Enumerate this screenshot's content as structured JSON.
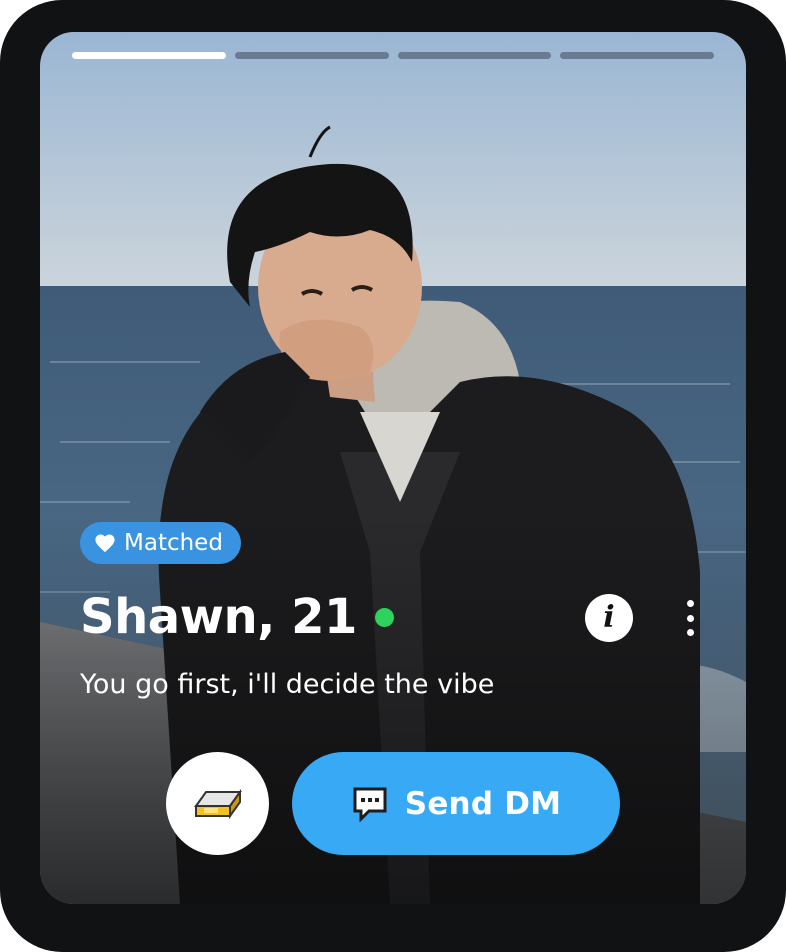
{
  "profile": {
    "badge": "Matched",
    "name_age": "Shawn, 21",
    "bio": "You go first, i'll decide the vibe",
    "online": true
  },
  "progress": {
    "total": 4,
    "active_index": 0
  },
  "actions": {
    "send_dm_label": "Send DM",
    "gift_icon": "gift-card-icon",
    "dm_icon": "chat-bubble-icon",
    "info_icon": "info-icon",
    "more_icon": "more-vertical-icon"
  },
  "colors": {
    "badge": "#3a93e0",
    "online": "#2dd35c",
    "dm_button": "#38a9f5",
    "progress_active": "#ffffff"
  }
}
